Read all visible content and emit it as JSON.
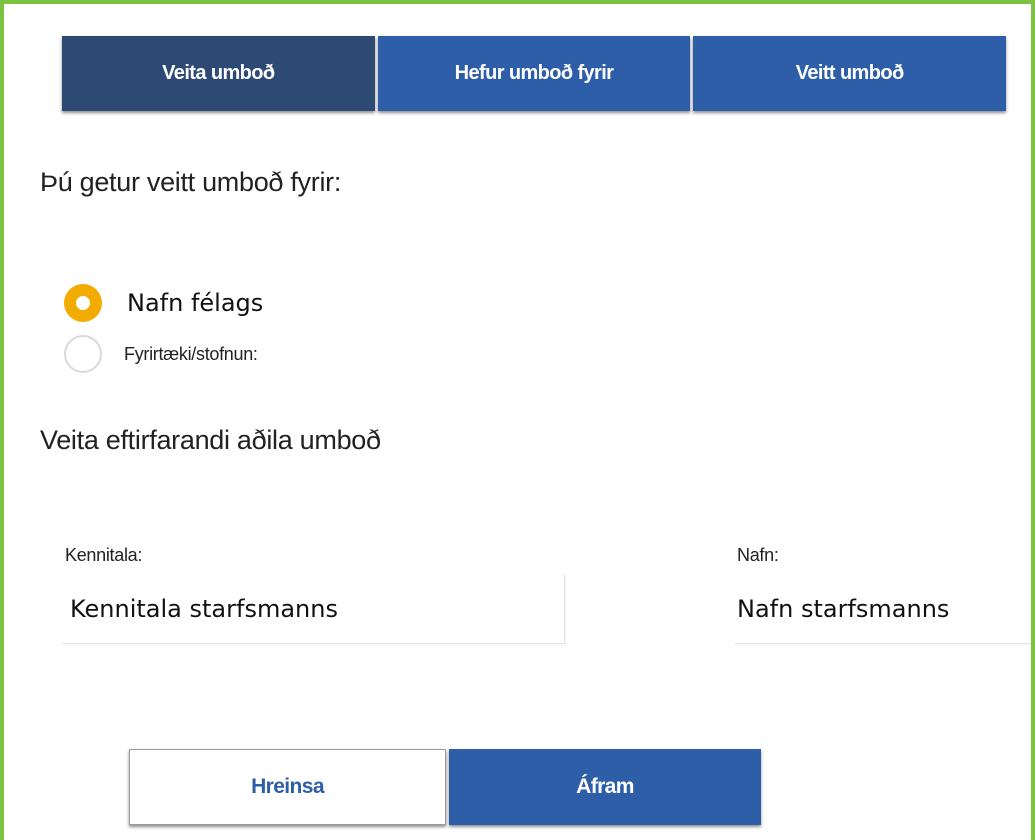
{
  "tabs": [
    {
      "label": "Veita umboð",
      "active": true
    },
    {
      "label": "Hefur umboð fyrir",
      "active": false
    },
    {
      "label": "Veitt umboð",
      "active": false
    }
  ],
  "section1": {
    "heading": "Þú getur veitt umboð fyrir:",
    "options": [
      {
        "label": "Nafn félags",
        "checked": true
      },
      {
        "label": "Fyrirtæki/stofnun:",
        "checked": false
      }
    ]
  },
  "section2": {
    "heading": "Veita eftirfarandi aðila umboð",
    "kennitala": {
      "label": "Kennitala:",
      "value": "Kennitala starfsmanns"
    },
    "nafn": {
      "label": "Nafn:",
      "value": "Nafn starfsmanns"
    }
  },
  "buttons": {
    "clear_label": "Hreinsa",
    "next_label": "Áfram"
  },
  "colors": {
    "frame_border": "#7dc243",
    "tab_active": "#2d4a75",
    "tab_default": "#2e5ea8",
    "radio_checked": "#f2ab00",
    "button_primary": "#2e5ea8"
  }
}
